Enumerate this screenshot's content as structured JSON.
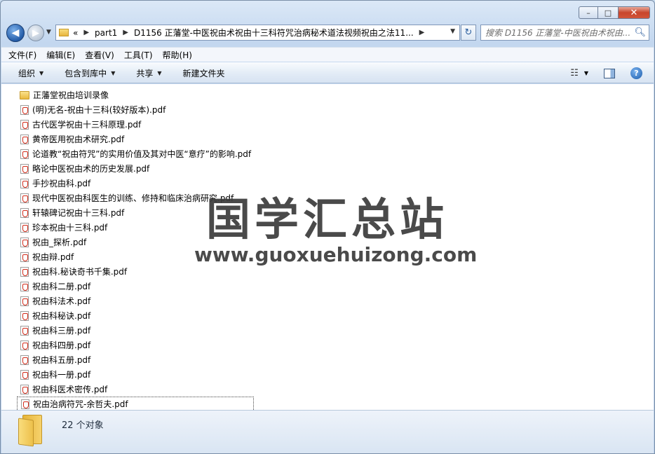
{
  "window": {
    "caption_buttons": {
      "minimize": "–",
      "maximize": "□",
      "close": "✕"
    }
  },
  "nav": {
    "back_glyph": "◀",
    "forward_glyph": "▶",
    "history_glyph": "▼",
    "address": {
      "overflow_glyph": "«",
      "crumbs": [
        "part1",
        "D1156 正藩堂-中医祝由术祝由十三科符咒治病秘术道法视频祝由之法11..."
      ],
      "sep_glyph": "▶",
      "dropdown_glyph": "▼"
    },
    "refresh_glyph": "↻",
    "search_placeholder": "搜索 D1156 正藩堂-中医祝由术祝由...",
    "search_icon": "magnifier-icon"
  },
  "menubar": {
    "items": [
      "文件(F)",
      "编辑(E)",
      "查看(V)",
      "工具(T)",
      "帮助(H)"
    ]
  },
  "toolbar": {
    "organize": "组织",
    "include_library": "包含到库中",
    "share": "共享",
    "new_folder": "新建文件夹",
    "caret": "▼",
    "views_icon": "☷",
    "help_glyph": "?"
  },
  "files": [
    {
      "name": "正藩堂祝由培训录像",
      "type": "folder"
    },
    {
      "name": "(明)无名-祝由十三科(较好版本).pdf",
      "type": "pdf"
    },
    {
      "name": "古代医学祝由十三科原理.pdf",
      "type": "pdf"
    },
    {
      "name": "黄帝医用祝由术研究.pdf",
      "type": "pdf"
    },
    {
      "name": "论道教“祝由符咒”的实用价值及其对中医“意疗”的影响.pdf",
      "type": "pdf"
    },
    {
      "name": "略论中医祝由术的历史发展.pdf",
      "type": "pdf"
    },
    {
      "name": "手抄祝由科.pdf",
      "type": "pdf"
    },
    {
      "name": "现代中医祝由科医生的训练、修持和临床治病研究.pdf",
      "type": "pdf"
    },
    {
      "name": "轩辕碑记祝由十三科.pdf",
      "type": "pdf"
    },
    {
      "name": "珍本祝由十三科.pdf",
      "type": "pdf"
    },
    {
      "name": "祝由_探析.pdf",
      "type": "pdf"
    },
    {
      "name": "祝由辩.pdf",
      "type": "pdf"
    },
    {
      "name": "祝由科.秘诀奇书千集.pdf",
      "type": "pdf"
    },
    {
      "name": "祝由科二册.pdf",
      "type": "pdf"
    },
    {
      "name": "祝由科法术.pdf",
      "type": "pdf"
    },
    {
      "name": "祝由科秘诀.pdf",
      "type": "pdf"
    },
    {
      "name": "祝由科三册.pdf",
      "type": "pdf"
    },
    {
      "name": "祝由科四册.pdf",
      "type": "pdf"
    },
    {
      "name": "祝由科五册.pdf",
      "type": "pdf"
    },
    {
      "name": "祝由科一册.pdf",
      "type": "pdf"
    },
    {
      "name": "祝由科医术密传.pdf",
      "type": "pdf"
    },
    {
      "name": "祝由治病符咒-余哲夫.pdf",
      "type": "pdf",
      "selected": true
    }
  ],
  "watermark": {
    "title": "国学汇总站",
    "url": "www.guoxuehuizong.com"
  },
  "details": {
    "object_count": "22 个对象"
  }
}
